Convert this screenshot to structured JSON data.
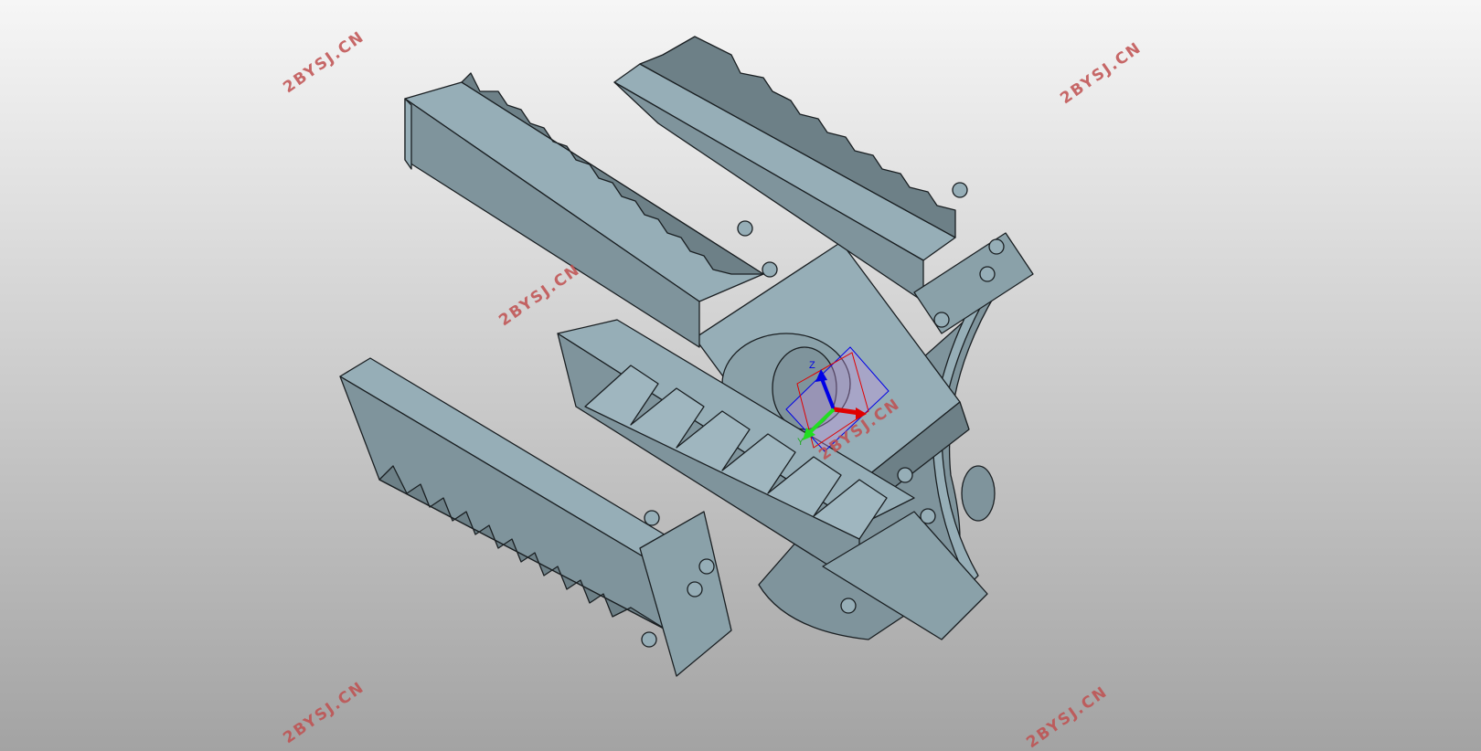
{
  "viewport": {
    "background_top": "#f6f6f6",
    "background_bottom": "#a3a3a3",
    "part_color_light": "#96aeb7",
    "part_color_mid": "#7f949c",
    "part_color_dark": "#6d8087",
    "edge_color": "#1a1f22"
  },
  "model": {
    "description_icon": "four-jaw-rack-gripper-3d-model"
  },
  "triad": {
    "axis_x_color": "#e00000",
    "axis_y_color": "#22dd22",
    "axis_z_color": "#0000e6",
    "label_y": "Y",
    "label_z": "Z"
  },
  "watermarks": {
    "text": "2BYSJ.CN",
    "color": "#c05050"
  }
}
